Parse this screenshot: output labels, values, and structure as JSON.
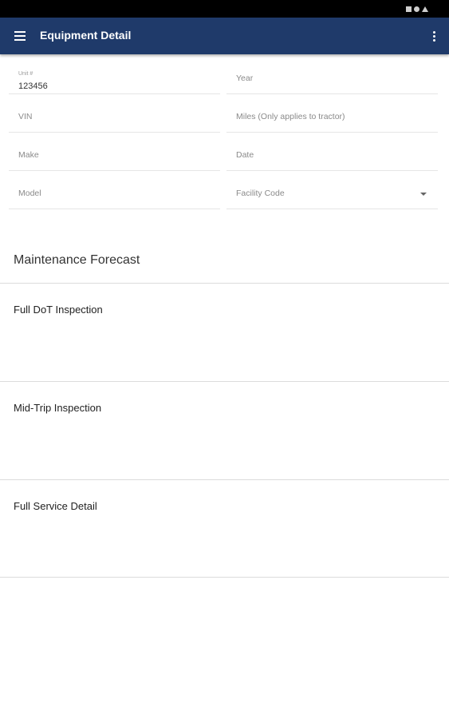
{
  "app_bar": {
    "title": "Equipment Detail",
    "menu_icon": "hamburger-menu-icon",
    "overflow_icon": "more-vert-icon",
    "color": "#1f3a6a"
  },
  "status_bar": {
    "icons": [
      "square-icon",
      "circle-icon",
      "triangle-icon"
    ]
  },
  "form": {
    "unit": {
      "label": "Unit #",
      "value": "123456"
    },
    "year": {
      "label": "Year",
      "value": ""
    },
    "vin": {
      "label": "VIN",
      "value": ""
    },
    "miles": {
      "label": "Miles (Only applies to tractor)",
      "value": ""
    },
    "make": {
      "label": "Make",
      "value": ""
    },
    "date": {
      "label": "Date",
      "value": ""
    },
    "model": {
      "label": "Model",
      "value": ""
    },
    "facility_code": {
      "label": "Facility Code",
      "value": ""
    }
  },
  "maintenance": {
    "title": "Maintenance Forecast",
    "items": [
      {
        "label": "Full DoT Inspection"
      },
      {
        "label": "Mid-Trip Inspection"
      },
      {
        "label": "Full Service Detail"
      }
    ]
  }
}
